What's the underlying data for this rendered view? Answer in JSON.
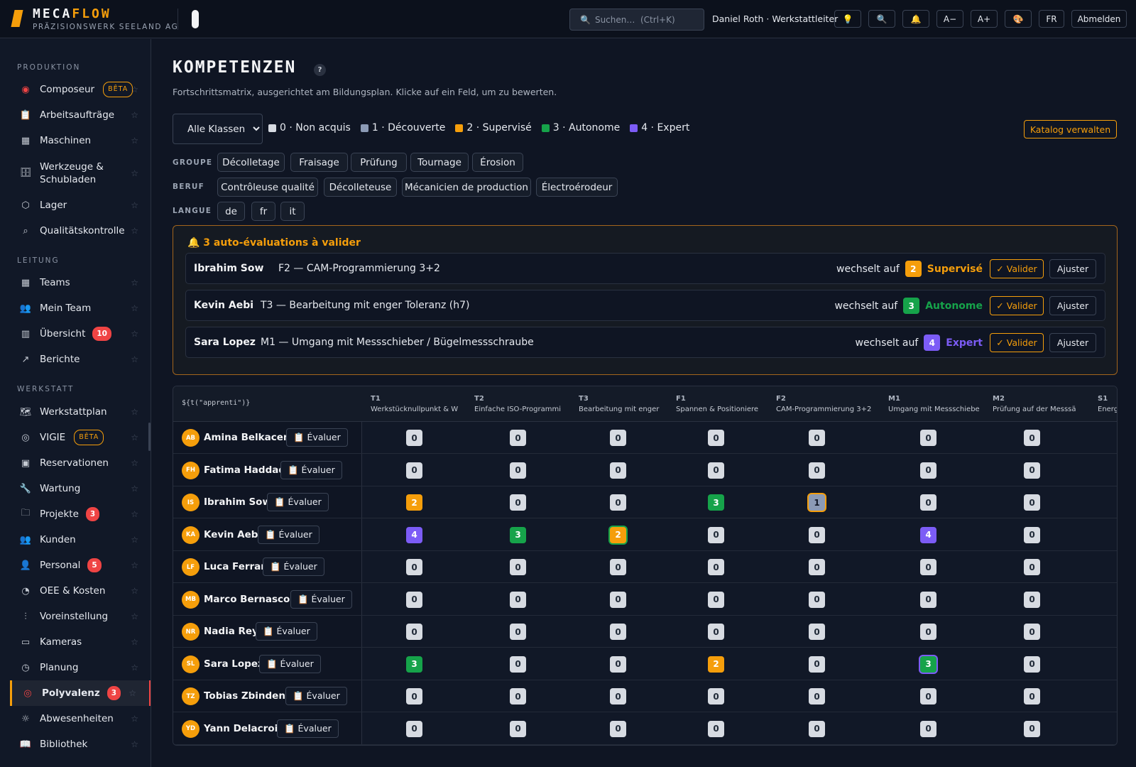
{
  "app": {
    "brand_a": "MECA",
    "brand_b": "FLOW",
    "company": "PRÄZISIONSWERK SEELAND AG"
  },
  "topbar": {
    "search_placeholder": "Suchen…  (Ctrl+K)",
    "user": "Daniel Roth · Werkstattleiter",
    "font_smaller": "A−",
    "font_larger": "A+",
    "lang": "FR",
    "logout": "Abmelden"
  },
  "sidebar": {
    "sections": [
      "PRODUKTION",
      "LEITUNG",
      "WERKSTATT"
    ],
    "produktion": [
      {
        "label": "Composeur",
        "icon": "composer-icon",
        "beta": "BÊTA"
      },
      {
        "label": "Arbeitsaufträge",
        "icon": "clipboard-icon"
      },
      {
        "label": "Maschinen",
        "icon": "grid-icon"
      },
      {
        "label": "Werkzeuge & Schubladen",
        "icon": "drawer-icon"
      },
      {
        "label": "Lager",
        "icon": "box-icon"
      },
      {
        "label": "Qualitätskontrolle",
        "icon": "search-icon"
      }
    ],
    "leitung": [
      {
        "label": "Teams",
        "icon": "grid-icon"
      },
      {
        "label": "Mein Team",
        "icon": "users-icon"
      },
      {
        "label": "Übersicht",
        "icon": "bar-chart-icon",
        "badge": "10"
      },
      {
        "label": "Berichte",
        "icon": "trend-icon"
      }
    ],
    "werkstatt": [
      {
        "label": "Werkstattplan",
        "icon": "map-icon"
      },
      {
        "label": "VIGIE",
        "icon": "target-icon",
        "beta": "BÊTA"
      },
      {
        "label": "Reservationen",
        "icon": "calendar-icon"
      },
      {
        "label": "Wartung",
        "icon": "wrench-icon"
      },
      {
        "label": "Projekte",
        "icon": "folder-icon",
        "badge": "3"
      },
      {
        "label": "Kunden",
        "icon": "users-icon"
      },
      {
        "label": "Personal",
        "icon": "user-icon",
        "badge": "5"
      },
      {
        "label": "OEE & Kosten",
        "icon": "gauge-icon"
      },
      {
        "label": "Voreinstellung",
        "icon": "sliders-icon"
      },
      {
        "label": "Kameras",
        "icon": "monitor-icon"
      },
      {
        "label": "Planung",
        "icon": "clock-icon"
      },
      {
        "label": "Polyvalenz",
        "icon": "bullseye-icon",
        "badge": "3",
        "active": true
      },
      {
        "label": "Abwesenheiten",
        "icon": "sun-icon"
      },
      {
        "label": "Bibliothek",
        "icon": "book-icon"
      }
    ]
  },
  "page": {
    "title": "KOMPETENZEN",
    "help": "?",
    "subtitle": "Fortschrittsmatrix, ausgerichtet am Bildungsplan. Klicke auf ein Feld, um zu bewerten.",
    "class_select": "Alle Klassen",
    "catalog_button": "Katalog verwalten"
  },
  "legend": [
    {
      "label": "0 · Non acquis",
      "color": "#d7dbe2"
    },
    {
      "label": "1 · Découverte",
      "color": "#8b9ab5"
    },
    {
      "label": "2 · Supervisé",
      "color": "#f59e0b"
    },
    {
      "label": "3 · Autonome",
      "color": "#16a34a"
    },
    {
      "label": "4 · Expert",
      "color": "#7c5cf6"
    }
  ],
  "filters": {
    "groupe_label": "GROUPE",
    "groupe": [
      "Décolletage",
      "Fraisage",
      "Prüfung",
      "Tournage",
      "Érosion"
    ],
    "beruf_label": "BERUF",
    "beruf": [
      "Contrôleuse qualité",
      "Décolleteuse",
      "Mécanicien de production",
      "Électroérodeur"
    ],
    "langue_label": "LANGUE",
    "langue": [
      "de",
      "fr",
      "it"
    ]
  },
  "validations": {
    "title": "🔔 3 auto-évaluations à valider",
    "switch_text": "wechselt auf",
    "valider": "✓ Valider",
    "ajuster": "Ajuster",
    "items": [
      {
        "name": "Ibrahim Sow",
        "competence": "F2 — CAM-Programmierung 3+2",
        "level": "2",
        "level_name": "Supervisé",
        "color": "#f59e0b"
      },
      {
        "name": "Kevin Aebi",
        "competence": "T3 — Bearbeitung mit enger Toleranz (h7)",
        "level": "3",
        "level_name": "Autonome",
        "color": "#16a34a"
      },
      {
        "name": "Sara Lopez",
        "competence": "M1 — Umgang mit Messschieber / Bügelmessschraube",
        "level": "4",
        "level_name": "Expert",
        "color": "#7c5cf6"
      }
    ]
  },
  "matrix": {
    "name_header": "${t(\"apprenti\")}",
    "eval_label": "📋 Évaluer",
    "columns": [
      {
        "code": "T1",
        "label": "Werkstücknullpunkt & W"
      },
      {
        "code": "T2",
        "label": "Einfache ISO-Programmi"
      },
      {
        "code": "T3",
        "label": "Bearbeitung mit enger"
      },
      {
        "code": "F1",
        "label": "Spannen & Positioniere"
      },
      {
        "code": "F2",
        "label": "CAM-Programmierung 3+2"
      },
      {
        "code": "M1",
        "label": "Umgang mit Messschiebe"
      },
      {
        "code": "M2",
        "label": "Prüfung auf der Messsä"
      },
      {
        "code": "S1",
        "label": "Energ"
      }
    ],
    "rows": [
      {
        "initials": "AB",
        "name": "Amina Belkacem",
        "values": [
          0,
          0,
          0,
          0,
          0,
          0,
          0
        ]
      },
      {
        "initials": "FH",
        "name": "Fatima Haddad",
        "values": [
          0,
          0,
          0,
          0,
          0,
          0,
          0
        ]
      },
      {
        "initials": "IS",
        "name": "Ibrahim Sow",
        "values": [
          2,
          0,
          0,
          3,
          1,
          0,
          0
        ],
        "pending": [
          4
        ]
      },
      {
        "initials": "KA",
        "name": "Kevin Aebi",
        "values": [
          4,
          3,
          2,
          0,
          0,
          4,
          0
        ],
        "pending": [
          2
        ]
      },
      {
        "initials": "LF",
        "name": "Luca Ferrari",
        "values": [
          0,
          0,
          0,
          0,
          0,
          0,
          0
        ]
      },
      {
        "initials": "MB",
        "name": "Marco Bernasconi",
        "values": [
          0,
          0,
          0,
          0,
          0,
          0,
          0
        ]
      },
      {
        "initials": "NR",
        "name": "Nadia Rey",
        "values": [
          0,
          0,
          0,
          0,
          0,
          0,
          0
        ]
      },
      {
        "initials": "SL",
        "name": "Sara Lopez",
        "values": [
          3,
          0,
          0,
          2,
          0,
          3,
          0
        ],
        "pending": [
          5
        ]
      },
      {
        "initials": "TZ",
        "name": "Tobias Zbinden",
        "values": [
          0,
          0,
          0,
          0,
          0,
          0,
          0
        ]
      },
      {
        "initials": "YD",
        "name": "Yann Delacroix",
        "values": [
          0,
          0,
          0,
          0,
          0,
          0,
          0
        ]
      }
    ]
  }
}
